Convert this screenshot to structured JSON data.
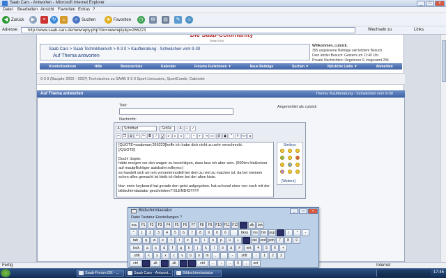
{
  "window": {
    "title": "Saab Cars - Antworten - Microsoft Internet Explorer",
    "buttons": {
      "min": "_",
      "max": "□",
      "close": "×"
    }
  },
  "menubar": [
    "Datei",
    "Bearbeiten",
    "Ansicht",
    "Favoriten",
    "Extras",
    "?"
  ],
  "toolbar": {
    "back": "Zurück",
    "search": "Suchen",
    "favorites": "Favoriten"
  },
  "address": {
    "label": "Adresse",
    "url": "http://www.saab-cars.de/newreply.php?do=newreply&p=266223",
    "go": "Wechseln zu",
    "links": "Links"
  },
  "site": {
    "logo": "Die Saab-Community",
    "since": "Since 2003",
    "breadcrumb": "Saab Cars > Saab Technikbereich > 9-3 II > Kaufberatung - Schwächen vom 9-3II",
    "page_title": "Auf Thema antworten",
    "welcome_line1": "Willkommen, cutsick.",
    "welcome_line2": "355 ungelesene Beiträge seit letztem Besuch.",
    "welcome_line3": "Dein letzter Besuch: Gestern um 11:40 Uhr",
    "welcome_line4": "Private Nachrichten: Ungelesen 0, insgesamt 294.",
    "nav": [
      "Kontrollzentrum",
      "Hilfe",
      "Benutzerliste",
      "Kalender",
      "Forums Funktionen ▼",
      "Neue Beiträge",
      "Suchen ▼",
      "Nützliche Links ▼",
      "Abmelden"
    ],
    "models": "9-3 II (Baujahr 2002 - 2007) Technisches zu SAAB 9-3 II Sport-Limousine, SportCombi, Cabriolet",
    "panel_title": "Auf Thema antworten",
    "panel_right": "Thema: Kaufberatung - Schwächen vom 9-3II",
    "label_title": "Titel:",
    "label_message": "Nachricht:",
    "logged_in": "Angemeldet als cutsick"
  },
  "editor": {
    "font_select": "Schriftart",
    "size_select": "Größe",
    "smilies_header": "Smileys",
    "smilies_more": "[Weitere]",
    "text": "[QUOTE=saabman;266223]hoffe ich habe dich nicht zu sehr verschreckt.\n[/QUOTE]\n\nDoch! :bigrin:\nhätte morgen vor den wagen zu besichtigen, dass lass ich aber sein. (500km hin&retour auf mautpflichtiger autobahn:rolleyes:)\nes handelt sich um ein vorseriennodell bei dem zu viel zu machen ist. da bei meinem schon alles gemacht ist bleib ich lieber bei der alten kiste.\n\nbtw: mein keyboard hat gerade den geist aufgegeben. hat schonal einer von euch mit der bildschirmtastatur geschrieben? ELENDIG!!!!!!!!"
  },
  "osk": {
    "title": "Bildschirmtastatur",
    "menu": "Datei   Tastatur   Einstellungen   ?",
    "rows": [
      [
        "esc",
        "F1",
        "F2",
        "F3",
        "F4",
        "F5",
        "F6",
        "F7",
        "F8",
        "F9",
        "F10",
        "F11",
        "F12",
        "",
        "slk",
        "brk"
      ],
      [
        "^",
        "1",
        "2",
        "3",
        "4",
        "5",
        "6",
        "7",
        "8",
        "9",
        "0",
        "ß",
        "´",
        "bksp",
        "ins",
        "hm",
        "pup",
        "",
        "/",
        "*",
        "-"
      ],
      [
        "tab",
        "q",
        "w",
        "e",
        "r",
        "t",
        "z",
        "u",
        "i",
        "o",
        "p",
        "ü",
        "+",
        "",
        "del",
        "end",
        "pdn",
        "7",
        "8",
        "9"
      ],
      [
        "lock",
        "a",
        "s",
        "d",
        "f",
        "g",
        "h",
        "j",
        "k",
        "l",
        "ö",
        "ä",
        "#",
        "ent",
        "4",
        "5",
        "6",
        "+"
      ],
      [
        "shft",
        "<",
        "y",
        "x",
        "c",
        "v",
        "b",
        "n",
        "m",
        ",",
        ".",
        "-",
        "shft",
        "↑",
        "1",
        "2",
        "3"
      ],
      [
        "ctrl",
        "",
        "alt",
        "",
        "alt",
        "",
        "",
        "ctrl",
        "←",
        "↓",
        "→",
        "0",
        ",",
        "ent"
      ]
    ]
  },
  "status": {
    "left": "Fertig",
    "zone": "Internet"
  },
  "taskbar": {
    "tasks": [
      "Saab-Forum.DE - ...",
      "Saab Cars - Antwort...",
      "Bildschirmtastatur"
    ],
    "clock": "17:45"
  }
}
